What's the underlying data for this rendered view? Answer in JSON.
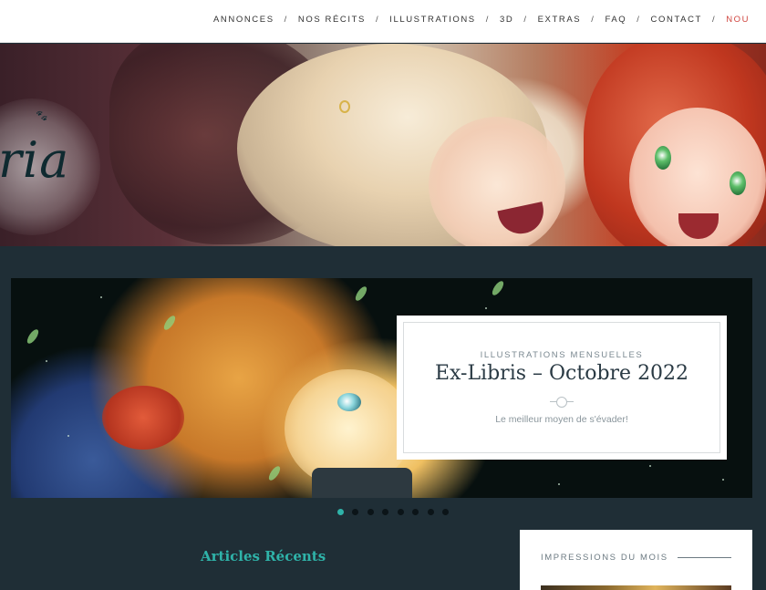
{
  "nav": {
    "items": [
      {
        "label": "ANNONCES"
      },
      {
        "label": "NOS RÉCITS"
      },
      {
        "label": "ILLUSTRATIONS"
      },
      {
        "label": "3D"
      },
      {
        "label": "EXTRAS"
      },
      {
        "label": "FAQ"
      },
      {
        "label": "CONTACT"
      },
      {
        "label": "NOU"
      }
    ],
    "separator": "/"
  },
  "banner": {
    "logo_text": "ria",
    "logo_icon": "paw-icon"
  },
  "slider": {
    "category": "ILLUSTRATIONS MENSUELLES",
    "title": "Ex-Libris – Octobre 2022",
    "subtitle": "Le meilleur moyen de s'évader!",
    "slide_count": 8,
    "active_slide": 1
  },
  "main": {
    "recent_title": "Articles Récents"
  },
  "sidebar": {
    "widget_title": "IMPRESSIONS DU MOIS"
  },
  "colors": {
    "background": "#1f2e36",
    "accent": "#2fb3a9",
    "nav_highlight": "#d0453f"
  }
}
